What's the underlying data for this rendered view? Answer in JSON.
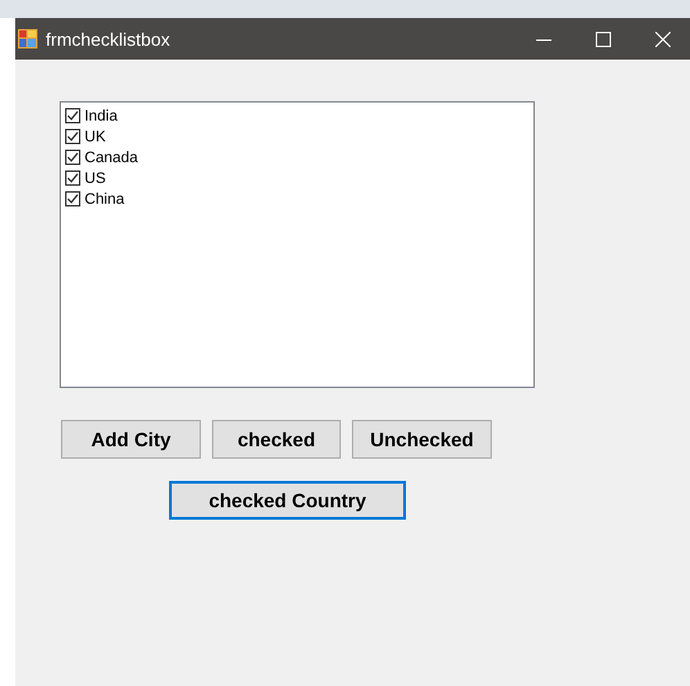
{
  "window": {
    "title": "frmchecklistbox"
  },
  "checklist": {
    "items": [
      {
        "label": "India",
        "checked": true
      },
      {
        "label": "UK",
        "checked": true
      },
      {
        "label": "Canada",
        "checked": true
      },
      {
        "label": "US",
        "checked": true
      },
      {
        "label": "China",
        "checked": true
      }
    ]
  },
  "button_rows": [
    [
      {
        "label": "Add City",
        "focused": false
      },
      {
        "label": "checked",
        "focused": false
      },
      {
        "label": "Unchecked",
        "focused": false
      }
    ],
    [
      {
        "label": "checked Country",
        "focused": true
      }
    ]
  ]
}
